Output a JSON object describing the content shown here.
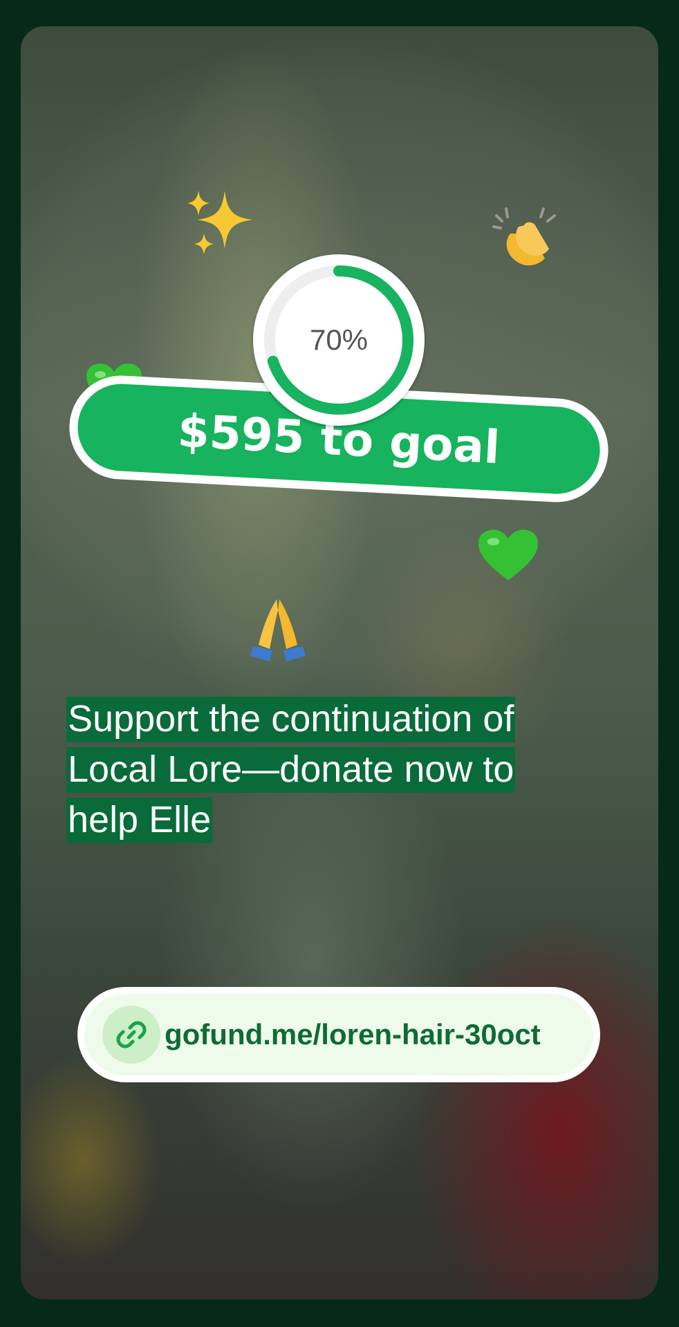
{
  "fundraiser": {
    "progress_percent": 70,
    "progress_label": "70%",
    "goal_text": "$595 to goal",
    "caption_lines": [
      "Support the continuation of",
      "Local Lore—donate now to",
      "help Elle"
    ],
    "link_text": "gofund.me/loren-hair-30oct"
  },
  "decorations": {
    "sparkles": "sparkles-emoji",
    "clap": "clapping-hands-emoji",
    "heart_left": "green-heart-emoji",
    "heart_right": "green-heart-emoji",
    "pray": "folded-hands-emoji",
    "link_icon": "link-icon"
  },
  "colors": {
    "accent_green": "#17b35e",
    "caption_highlight": "#0a6b3a",
    "link_text": "#0f6b35",
    "frame_background": "#062a17"
  }
}
